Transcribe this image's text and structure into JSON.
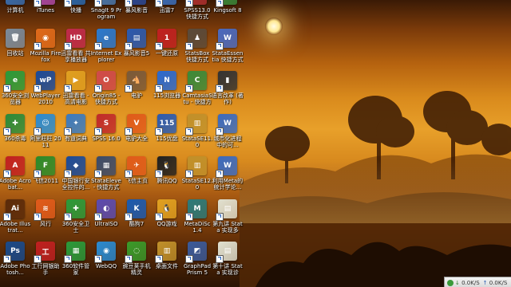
{
  "desktop": {
    "icons": [
      {
        "label": "计算机",
        "color": "#3a6fb0",
        "glyph": "▣",
        "icon": "computer-icon"
      },
      {
        "label": "iTunes",
        "color": "#b04aa8",
        "glyph": "♪",
        "icon": "music-icon"
      },
      {
        "label": "快播",
        "color": "#2a6ab0",
        "glyph": "▶",
        "icon": "player-icon"
      },
      {
        "label": "SnagIt 9 Program",
        "color": "#4a7ab0",
        "glyph": "S",
        "icon": "snagit-icon"
      },
      {
        "label": "暴风影音",
        "color": "#2a4a9a",
        "glyph": "◎",
        "icon": "video-icon"
      },
      {
        "label": "迅雷7",
        "color": "#3a70c0",
        "glyph": "⚡",
        "icon": "download-icon"
      },
      {
        "label": "SPSS13.0 快捷方式",
        "color": "#b03030",
        "glyph": "S",
        "icon": "spss-icon"
      },
      {
        "label": "Kingsoft 8",
        "color": "#3a8a3a",
        "glyph": "K",
        "icon": "kingsoft-icon"
      },
      {
        "label": "回收站",
        "color": "#7a8a9a",
        "glyph": "🗑",
        "icon": "recycle-bin-icon"
      },
      {
        "label": "Mozilla Firefox",
        "color": "#e06a1a",
        "glyph": "◉",
        "icon": "firefox-icon"
      },
      {
        "label": "迅雷看看 共享播放器",
        "color": "#c02a4a",
        "glyph": "HD",
        "icon": "hd-player-icon"
      },
      {
        "label": "Internet Explorer",
        "color": "#2a7ad0",
        "glyph": "e",
        "icon": "ie-icon"
      },
      {
        "label": "暴风影音5",
        "color": "#2a5ab0",
        "glyph": "▤",
        "icon": "media-icon"
      },
      {
        "label": "一键还原",
        "color": "#c02020",
        "glyph": "1",
        "icon": "restore-icon"
      },
      {
        "label": "StatsBox 快捷方式",
        "color": "#5a4a3a",
        "glyph": "♟",
        "icon": "statsbox-icon"
      },
      {
        "label": "StataEssentia 快捷方式",
        "color": "#4a6ac0",
        "glyph": "W",
        "icon": "word-doc-icon"
      },
      {
        "label": "360安全浏览器",
        "color": "#2a9a3a",
        "glyph": "e",
        "icon": "browser-360-icon"
      },
      {
        "label": "WebPlayer 2010",
        "color": "#1a4a9a",
        "glyph": "wP",
        "icon": "webplayer-icon"
      },
      {
        "label": "迅雷看看 - 高清电影",
        "color": "#e0a020",
        "glyph": "▶",
        "icon": "video-hd-icon"
      },
      {
        "label": "Origin85 - 快捷方式",
        "color": "#d04a4a",
        "glyph": "O",
        "icon": "origin-icon"
      },
      {
        "label": "电驴",
        "color": "#7a5a3a",
        "glyph": "🐴",
        "icon": "donkey-icon"
      },
      {
        "label": "115浏览器",
        "color": "#2a6ad0",
        "glyph": "N",
        "icon": "browser-115-icon"
      },
      {
        "label": "CamtasiaStu - 快捷方式",
        "color": "#3a8a3a",
        "glyph": "C",
        "icon": "camtasia-icon"
      },
      {
        "label": "语言改革 (著作)",
        "color": "#333333",
        "glyph": "▮",
        "icon": "book-icon"
      },
      {
        "label": "360杀毒",
        "color": "#2a8a3a",
        "glyph": "✚",
        "icon": "antivirus-icon"
      },
      {
        "label": "阿里旺旺 2011",
        "color": "#2a8ad0",
        "glyph": "☺",
        "icon": "wangwang-icon"
      },
      {
        "label": "有道词典",
        "color": "#3a7ac0",
        "glyph": "✦",
        "icon": "dictionary-icon"
      },
      {
        "label": "SPSS 16.0",
        "color": "#c02a2a",
        "glyph": "S",
        "icon": "spss16-icon"
      },
      {
        "label": "电驴大全",
        "color": "#e05a1a",
        "glyph": "V",
        "icon": "ed2k-icon"
      },
      {
        "label": "115优盘",
        "color": "#2a5ab0",
        "glyph": "115",
        "icon": "usb-115-icon"
      },
      {
        "label": "StataSE11.0",
        "color": "#c0902a",
        "glyph": "▥",
        "icon": "folder-stata11-icon"
      },
      {
        "label": "城市化进程中的可...",
        "color": "#3a6ac0",
        "glyph": "W",
        "icon": "word-doc2-icon"
      },
      {
        "label": "Adobe Acrobat...",
        "color": "#c02020",
        "glyph": "A",
        "icon": "acrobat-icon"
      },
      {
        "label": "飞信2011",
        "color": "#2a8a2a",
        "glyph": "F",
        "icon": "fetion-icon"
      },
      {
        "label": "中国银行安全控件的...",
        "color": "#1a4a9a",
        "glyph": "◆",
        "icon": "bank-icon"
      },
      {
        "label": "StataEleve - 快捷方式",
        "color": "#3a4a6a",
        "glyph": "▦",
        "icon": "stata-icon"
      },
      {
        "label": "飞信主页",
        "color": "#e05a1a",
        "glyph": "✈",
        "icon": "fetion-home-icon"
      },
      {
        "label": "腾讯QQ",
        "color": "#202020",
        "glyph": "🐧",
        "icon": "qq-icon"
      },
      {
        "label": "StataSE12.0",
        "color": "#c0902a",
        "glyph": "▥",
        "icon": "folder-stata12-icon"
      },
      {
        "label": "利用Meta的统计学论...",
        "color": "#3a6ac0",
        "glyph": "W",
        "icon": "word-doc3-icon"
      },
      {
        "label": "Adobe Illustrat...",
        "color": "#5a2a0a",
        "glyph": "Ai",
        "icon": "illustrator-icon"
      },
      {
        "label": "风行",
        "color": "#e05a1a",
        "glyph": "≋",
        "icon": "funshion-icon"
      },
      {
        "label": "360安全卫士",
        "color": "#2a9a3a",
        "glyph": "✚",
        "icon": "security-360-icon"
      },
      {
        "label": "UltraISO",
        "color": "#5a4ab0",
        "glyph": "◐",
        "icon": "ultraiso-icon"
      },
      {
        "label": "酷狗7",
        "color": "#1a5ab0",
        "glyph": "K",
        "icon": "kugou-icon"
      },
      {
        "label": "QQ游戏",
        "color": "#e0a020",
        "glyph": "🐧",
        "icon": "qq-game-icon"
      },
      {
        "label": "MetaDiSc 1.4",
        "color": "#2a7a7a",
        "glyph": "M",
        "icon": "metadisc-icon"
      },
      {
        "label": "第九讲 Stata 实现多元...",
        "color": "#e0e0d0",
        "glyph": "▤",
        "icon": "document-icon"
      },
      {
        "label": "Adobe Photosh...",
        "color": "#1a4a8a",
        "glyph": "Ps",
        "icon": "photoshop-icon"
      },
      {
        "label": "工行网银助手",
        "color": "#c02020",
        "glyph": "工",
        "icon": "icbc-icon"
      },
      {
        "label": "360软件管家",
        "color": "#2a9a3a",
        "glyph": "▦",
        "icon": "software-manager-icon"
      },
      {
        "label": "WebQQ",
        "color": "#2a8ad0",
        "glyph": "◉",
        "icon": "webqq-icon"
      },
      {
        "label": "豌豆荚手机精灵",
        "color": "#3a9a2a",
        "glyph": "◌",
        "icon": "wandoujia-icon"
      },
      {
        "label": "桌面文件",
        "color": "#c0902a",
        "glyph": "▥",
        "icon": "desktop-folder-icon"
      },
      {
        "label": "GraphPad Prism 5",
        "color": "#3a5a9a",
        "glyph": "◩",
        "icon": "graphpad-icon"
      },
      {
        "label": "第十讲 Stata 实现诊断...",
        "color": "#e0e0d0",
        "glyph": "▤",
        "icon": "document2-icon"
      }
    ]
  },
  "tray": {
    "download": "0.0K/S",
    "upload": "0.0K/S"
  }
}
